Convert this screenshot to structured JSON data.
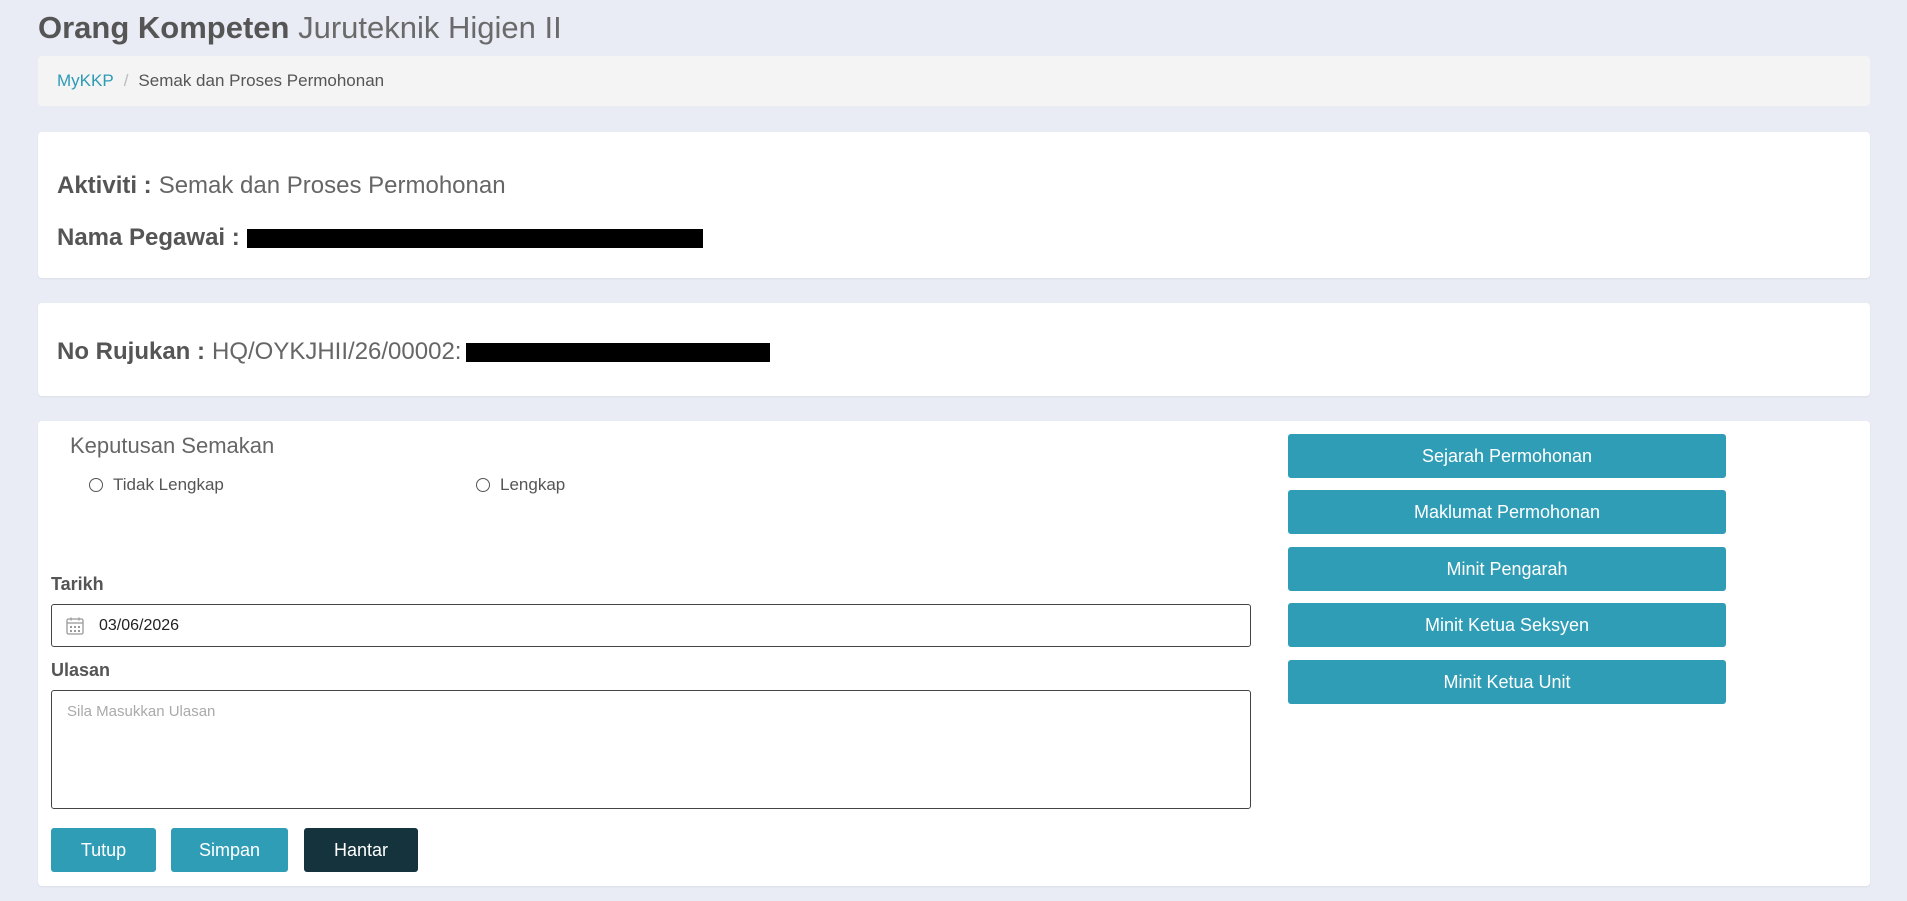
{
  "header": {
    "title_bold": "Orang Kompeten",
    "title_light": "Juruteknik Higien II"
  },
  "breadcrumb": {
    "home": "MyKKP",
    "separator": "/",
    "current": "Semak dan Proses Permohonan"
  },
  "info": {
    "activity_label": "Aktiviti :",
    "activity_value": "Semak dan Proses Permohonan",
    "employee_label": "Nama Pegawai :"
  },
  "reference": {
    "label": "No Rujukan :",
    "value": "HQ/OYKJHII/26/00002:"
  },
  "decision": {
    "title": "Keputusan Semakan",
    "options": [
      "Tidak Lengkap",
      "Lengkap"
    ]
  },
  "form": {
    "date_label": "Tarikh",
    "date_value": "03/06/2026",
    "comment_label": "Ulasan",
    "comment_placeholder": "Sila Masukkan Ulasan"
  },
  "actions": {
    "close": "Tutup",
    "save": "Simpan",
    "submit": "Hantar"
  },
  "side_buttons": [
    "Sejarah Permohonan",
    "Maklumat Permohonan",
    "Minit Pengarah",
    "Minit Ketua Seksyen",
    "Minit Ketua Unit"
  ],
  "colors": {
    "page_bg": "#e9ecf5",
    "accent": "#309db7",
    "dark_button": "#14333d",
    "link": "#2e9ab5"
  },
  "icons": {
    "date": "calendar-icon"
  }
}
